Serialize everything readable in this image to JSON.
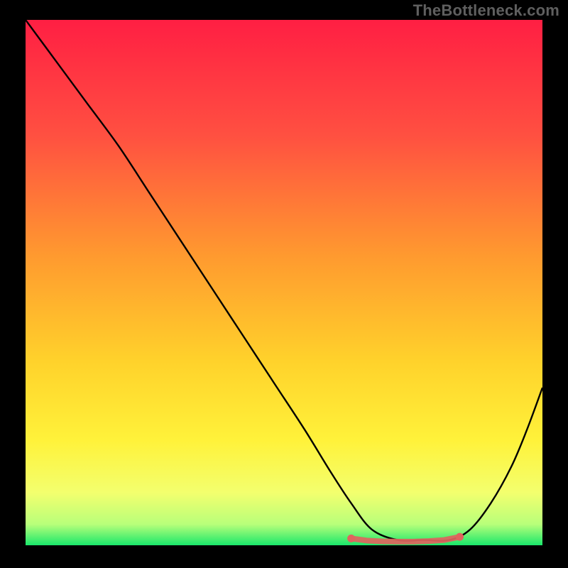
{
  "watermark": "TheBottleneck.com",
  "colors": {
    "background": "#000000",
    "watermark": "#5f5f5f",
    "curve_stroke": "#000000",
    "marker_fill": "#e0645e",
    "bottom_band": "#1ae76b"
  },
  "chart_data": {
    "type": "line",
    "title": "",
    "xlabel": "",
    "ylabel": "",
    "xlim": [
      0,
      100
    ],
    "ylim": [
      0,
      100
    ],
    "gradient_stops": [
      {
        "offset": 0,
        "color": "#ff1f43"
      },
      {
        "offset": 22,
        "color": "#ff5041"
      },
      {
        "offset": 45,
        "color": "#ff9a2f"
      },
      {
        "offset": 65,
        "color": "#ffd22b"
      },
      {
        "offset": 80,
        "color": "#fff23a"
      },
      {
        "offset": 90,
        "color": "#f3ff6e"
      },
      {
        "offset": 96,
        "color": "#b8ff7a"
      },
      {
        "offset": 100,
        "color": "#1ae76b"
      }
    ],
    "series": [
      {
        "name": "bottleneck-curve",
        "x": [
          0,
          6,
          12,
          18,
          24,
          30,
          36,
          42,
          48,
          54,
          59,
          63,
          67,
          72,
          77,
          82,
          86,
          90,
          94,
          97,
          100
        ],
        "y": [
          100,
          92,
          84,
          76,
          67,
          58,
          49,
          40,
          31,
          22,
          14,
          8,
          3,
          1,
          1,
          1,
          3,
          8,
          15,
          22,
          30
        ]
      }
    ],
    "markers": {
      "name": "highlight-band",
      "x": [
        63,
        66,
        69,
        72,
        75,
        78,
        81,
        84
      ],
      "y": [
        1.3,
        0.9,
        0.75,
        0.7,
        0.7,
        0.8,
        1.0,
        1.6
      ]
    }
  }
}
